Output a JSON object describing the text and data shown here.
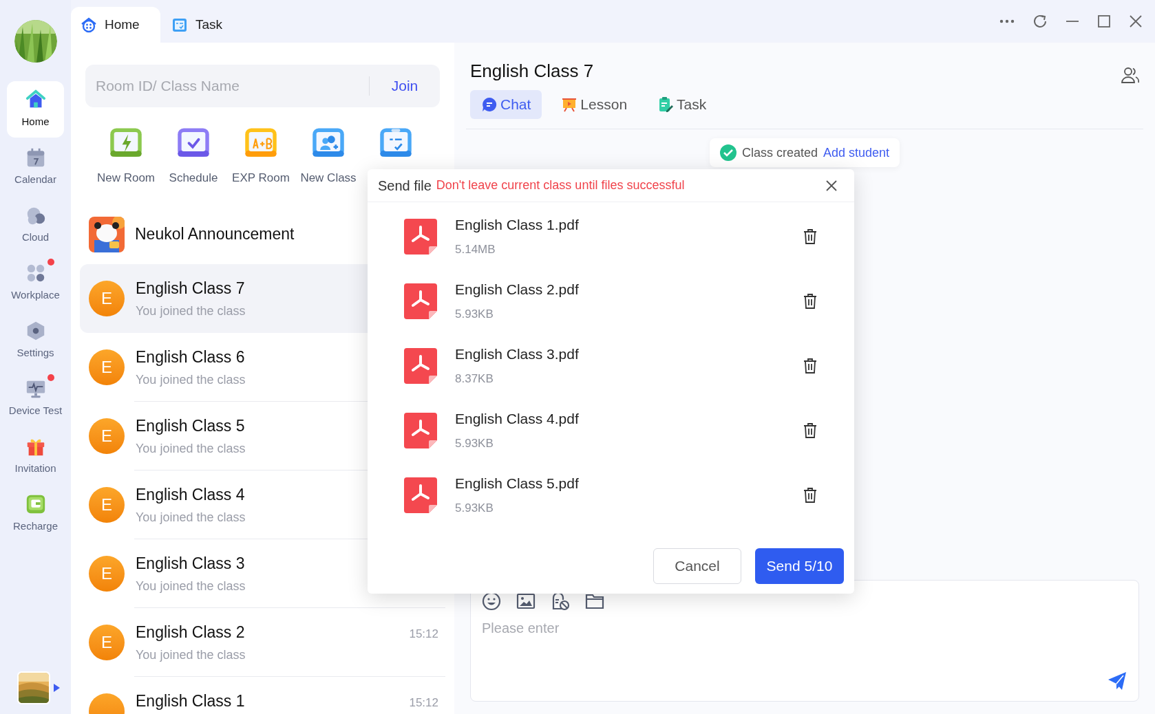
{
  "sidebar": {
    "items": [
      {
        "label": "Home",
        "kind": "home",
        "selected": true,
        "badge": false
      },
      {
        "label": "Calendar",
        "kind": "calendar",
        "selected": false,
        "badge": false
      },
      {
        "label": "Cloud",
        "kind": "cloud",
        "selected": false,
        "badge": false
      },
      {
        "label": "Workplace",
        "kind": "grid",
        "selected": false,
        "badge": true
      },
      {
        "label": "Settings",
        "kind": "hexagon",
        "selected": false,
        "badge": false
      },
      {
        "label": "Device Test",
        "kind": "monitor",
        "selected": false,
        "badge": true
      },
      {
        "label": "Invitation",
        "kind": "gift",
        "selected": false,
        "badge": false
      },
      {
        "label": "Recharge",
        "kind": "wallet",
        "selected": false,
        "badge": false
      }
    ]
  },
  "top_tabs": [
    {
      "label": "Home",
      "kind": "home",
      "selected": true
    },
    {
      "label": "Task",
      "kind": "checklist",
      "selected": false
    }
  ],
  "search": {
    "placeholder": "Room ID/ Class Name",
    "button": "Join"
  },
  "quick_actions": [
    {
      "label": "New Room",
      "kind": "bolt"
    },
    {
      "label": "Schedule",
      "kind": "check"
    },
    {
      "label": "EXP Room",
      "kind": "ab"
    },
    {
      "label": "New Class",
      "kind": "people"
    },
    {
      "kind": "checklist"
    }
  ],
  "conversations": [
    {
      "kind": "announcement",
      "title": "Neukol Announcement",
      "selected": false
    },
    {
      "kind": "class",
      "avatar": "E",
      "title": "English Class 7",
      "subtitle": "You joined the class",
      "selected": true
    },
    {
      "kind": "class",
      "avatar": "E",
      "title": "English Class 6",
      "subtitle": "You joined the class",
      "selected": false
    },
    {
      "kind": "class",
      "avatar": "E",
      "title": "English Class 5",
      "subtitle": "You joined the class",
      "selected": false
    },
    {
      "kind": "class",
      "avatar": "E",
      "title": "English Class 4",
      "subtitle": "You joined the class",
      "selected": false
    },
    {
      "kind": "class",
      "avatar": "E",
      "title": "English Class 3",
      "subtitle": "You joined the class",
      "selected": false
    },
    {
      "kind": "class",
      "avatar": "E",
      "title": "English Class 2",
      "subtitle": "You joined the class",
      "time": "15:12",
      "selected": false
    },
    {
      "kind": "class",
      "title": "English Class 1",
      "time": "15:12",
      "selected": false
    }
  ],
  "chat": {
    "title": "English Class 7",
    "tabs": [
      {
        "label": "Chat",
        "kind": "chat",
        "selected": true
      },
      {
        "label": "Lesson",
        "kind": "lesson",
        "selected": false
      },
      {
        "label": "Task",
        "kind": "task",
        "selected": false
      }
    ],
    "toast": {
      "text": "Class created",
      "link": "Add student"
    },
    "input": {
      "placeholder": "Please enter"
    }
  },
  "dialog": {
    "title": "Send file",
    "warning": "Don't leave current class until files successful",
    "files": [
      {
        "name": "English Class 1.pdf",
        "size": "5.14MB"
      },
      {
        "name": "English Class 2.pdf",
        "size": "5.93KB"
      },
      {
        "name": "English Class 3.pdf",
        "size": "8.37KB"
      },
      {
        "name": "English Class 4.pdf",
        "size": "5.93KB"
      },
      {
        "name": "English Class 5.pdf",
        "size": "5.93KB"
      }
    ],
    "cancel": "Cancel",
    "send": "Send 5/10"
  }
}
